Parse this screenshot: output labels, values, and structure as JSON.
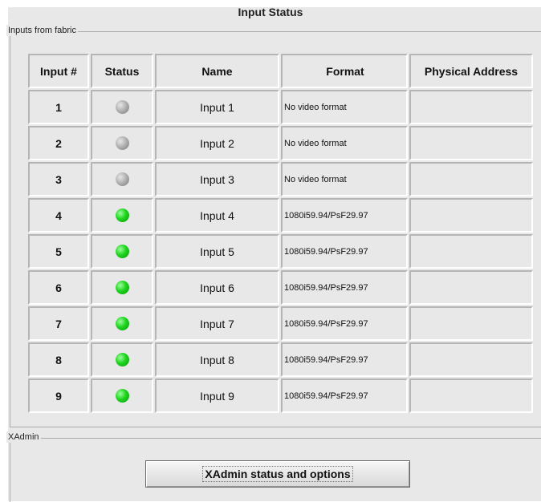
{
  "title": "Input Status",
  "group_inputs": {
    "legend": "Inputs from fabric"
  },
  "table": {
    "headers": [
      "Input #",
      "Status",
      "Name",
      "Format",
      "Physical Address"
    ],
    "rows": [
      {
        "num": "1",
        "status": "inactive",
        "name": "Input 1",
        "format": "No video format",
        "address": ""
      },
      {
        "num": "2",
        "status": "inactive",
        "name": "Input 2",
        "format": "No video format",
        "address": ""
      },
      {
        "num": "3",
        "status": "inactive",
        "name": "Input 3",
        "format": "No video format",
        "address": ""
      },
      {
        "num": "4",
        "status": "active",
        "name": "Input 4",
        "format": "1080i59.94/PsF29.97",
        "address": ""
      },
      {
        "num": "5",
        "status": "active",
        "name": "Input 5",
        "format": "1080i59.94/PsF29.97",
        "address": ""
      },
      {
        "num": "6",
        "status": "active",
        "name": "Input 6",
        "format": "1080i59.94/PsF29.97",
        "address": ""
      },
      {
        "num": "7",
        "status": "active",
        "name": "Input 7",
        "format": "1080i59.94/PsF29.97",
        "address": ""
      },
      {
        "num": "8",
        "status": "active",
        "name": "Input 8",
        "format": "1080i59.94/PsF29.97",
        "address": ""
      },
      {
        "num": "9",
        "status": "active",
        "name": "Input 9",
        "format": "1080i59.94/PsF29.97",
        "address": ""
      }
    ]
  },
  "status_colors": {
    "active": "#1fd41f",
    "inactive": "#a8a8a8"
  },
  "group_xadmin": {
    "legend": "XAdmin",
    "button_label": "XAdmin status and options"
  }
}
